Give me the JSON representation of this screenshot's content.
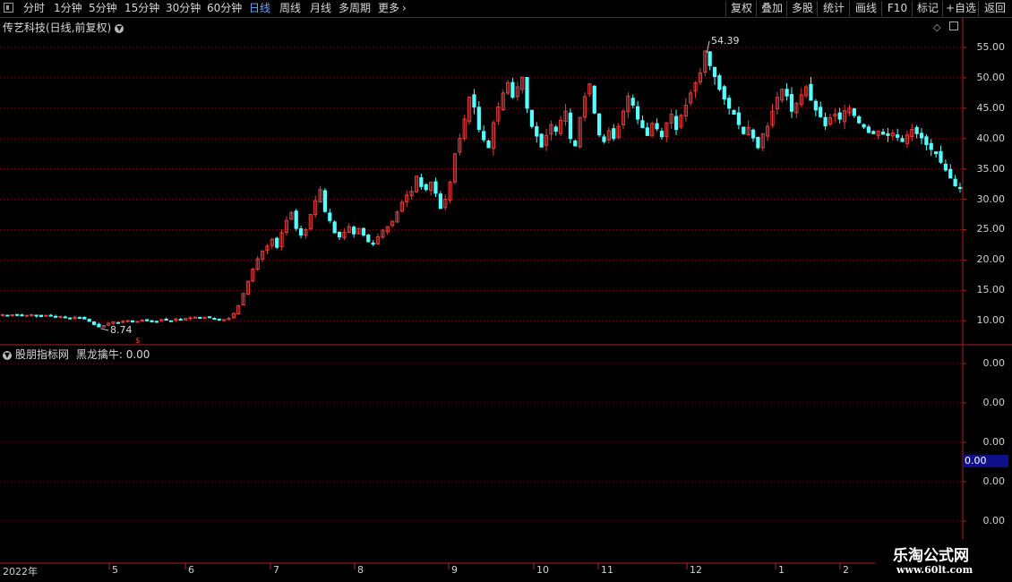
{
  "toolbar": {
    "periods": [
      "分时",
      "1分钟",
      "5分钟",
      "15分钟",
      "30分钟",
      "60分钟",
      "日线",
      "周线",
      "月线",
      "多周期",
      "更多"
    ],
    "active_period": "日线",
    "right_buttons": [
      "复权",
      "叠加",
      "多股",
      "统计",
      "画线",
      "F10",
      "标记",
      "+自选",
      "返回"
    ]
  },
  "main": {
    "title": "传艺科技(日线,前复权)",
    "max_label": "54.39",
    "min_label": "8.74"
  },
  "indicator": {
    "title": "股朋指标网",
    "label": "黑龙擒牛: 0.00",
    "current_value": "0.00"
  },
  "x_axis": {
    "year": "2022年",
    "months": [
      "5",
      "6",
      "7",
      "8",
      "9",
      "10",
      "11",
      "12",
      "1",
      "2"
    ]
  },
  "logo": {
    "line1": "乐淘公式网",
    "line2": "www.60lt.com"
  },
  "colors": {
    "up": "#e83a3a",
    "down": "#54ffff",
    "grid": "#7a1010",
    "border": "#b02020"
  },
  "chart_data": {
    "type": "candlestick",
    "title": "传艺科技(日线,前复权)",
    "y_ticks": [
      "55.00",
      "50.00",
      "45.00",
      "40.00",
      "35.00",
      "30.00",
      "25.00",
      "20.00",
      "15.00",
      "10.00"
    ],
    "indicator_y_ticks": [
      "0.00",
      "0.00",
      "0.00",
      "0.00",
      "0.00"
    ],
    "ylim": [
      6.5,
      57.5
    ],
    "high": 54.39,
    "low": 8.74,
    "close_series": [
      11.0,
      10.9,
      11.0,
      10.9,
      10.8,
      10.9,
      11.0,
      10.8,
      10.7,
      10.9,
      10.8,
      10.6,
      10.7,
      10.5,
      10.4,
      10.6,
      10.5,
      10.3,
      9.9,
      9.4,
      9.0,
      9.2,
      9.6,
      9.8,
      9.7,
      9.9,
      10.0,
      9.8,
      9.9,
      10.1,
      10.0,
      9.8,
      9.9,
      10.2,
      10.1,
      10.0,
      10.3,
      10.2,
      10.4,
      10.5,
      10.6,
      10.4,
      10.6,
      10.5,
      10.3,
      10.1,
      10.2,
      10.4,
      11.2,
      12.5,
      14.5,
      16.5,
      18.5,
      20.2,
      21.5,
      22.3,
      23.4,
      22.1,
      24.5,
      26.5,
      27.8,
      25.2,
      24.1,
      25.0,
      27.5,
      29.8,
      31.6,
      28.0,
      26.5,
      24.5,
      23.8,
      24.6,
      25.5,
      24.3,
      25.2,
      24.1,
      23.0,
      22.6,
      23.8,
      24.9,
      25.5,
      26.4,
      27.9,
      29.5,
      30.7,
      31.3,
      33.8,
      32.1,
      31.6,
      32.8,
      31.0,
      28.5,
      30.0,
      32.8,
      37.5,
      40.0,
      43.2,
      46.8,
      45.2,
      41.5,
      39.8,
      38.5,
      42.6,
      45.2,
      47.5,
      49.2,
      46.8,
      48.5,
      50.1,
      45.0,
      42.0,
      40.4,
      38.6,
      40.5,
      42.3,
      41.2,
      43.0,
      44.5,
      40.0,
      38.8,
      43.5,
      46.9,
      49.0,
      44.2,
      40.6,
      39.5,
      41.3,
      40.0,
      42.0,
      44.5,
      47.0,
      45.5,
      43.2,
      41.8,
      40.5,
      42.5,
      41.6,
      40.3,
      42.6,
      44.0,
      41.5,
      43.8,
      45.5,
      47.5,
      49.2,
      50.8,
      54.4,
      52.0,
      50.2,
      48.1,
      46.5,
      45.0,
      44.0,
      42.3,
      40.8,
      41.8,
      40.1,
      38.5,
      40.8,
      42.0,
      44.5,
      46.8,
      48.1,
      47.0,
      44.5,
      45.8,
      47.2,
      48.5,
      46.3,
      44.7,
      43.6,
      42.1,
      43.4,
      44.0,
      43.2,
      44.6,
      45.0,
      43.8,
      42.6,
      41.9,
      41.0,
      40.8,
      41.2,
      40.7,
      40.5,
      40.9,
      40.2,
      39.5,
      40.6,
      41.5,
      40.8,
      40.1,
      39.0,
      38.2,
      37.5,
      36.1,
      34.8,
      33.5,
      32.2,
      31.8
    ]
  }
}
